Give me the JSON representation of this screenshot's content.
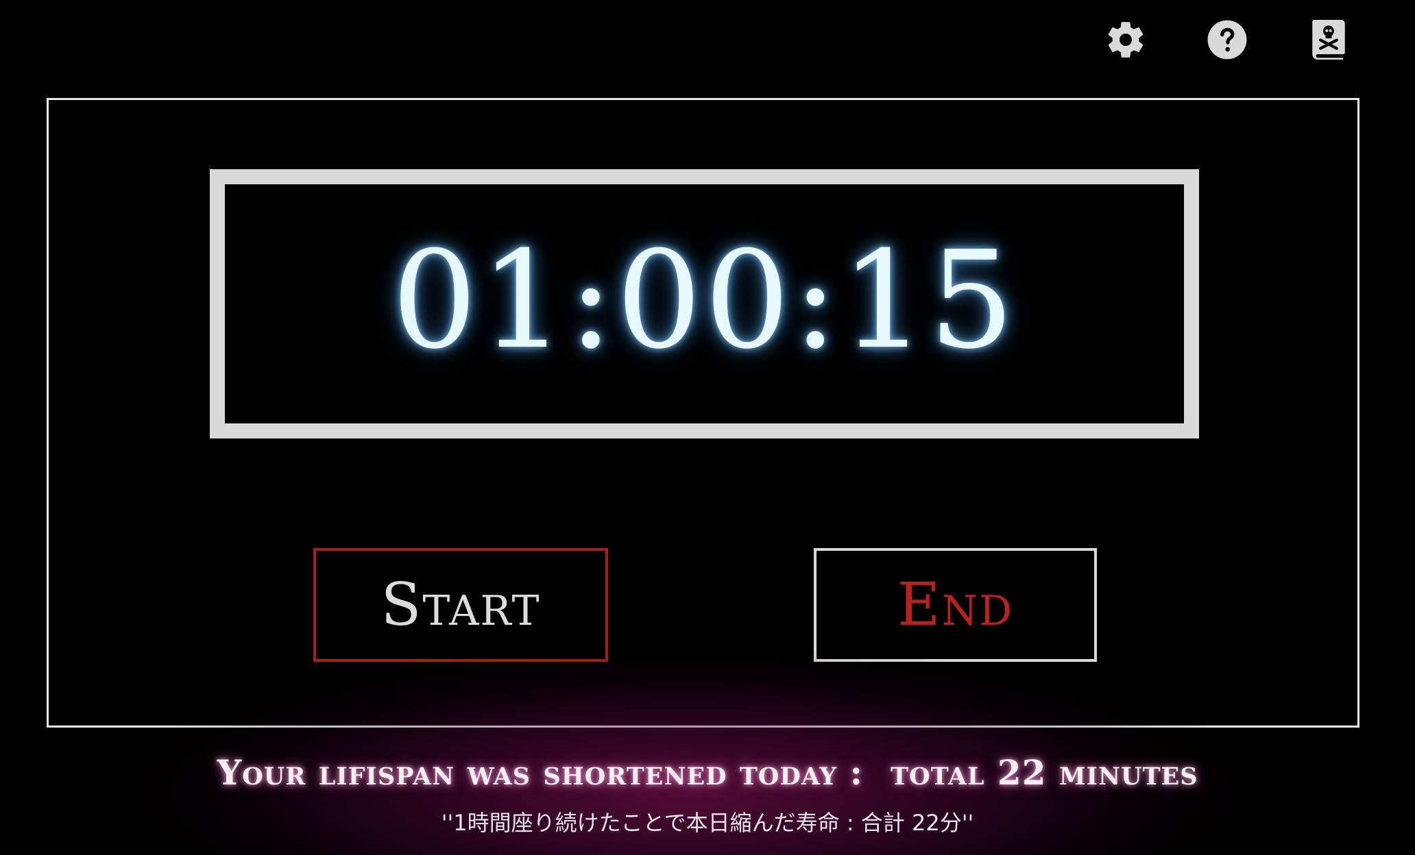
{
  "toolbar": {
    "icons": [
      "gear-icon",
      "help-icon",
      "skull-book-icon"
    ]
  },
  "timer": {
    "display": "01:00:15"
  },
  "buttons": {
    "start_label": "Start",
    "end_label": "End"
  },
  "lifespan": {
    "message": "Your lifispan was shortened today :",
    "total": "total 22 minutes",
    "japanese": "''1時間座り続けたことで本日縮んだ寿命 : 合計 22分''"
  },
  "colors": {
    "background": "#000000",
    "timer_glow": "#82c8ff",
    "start_border": "#a3221d",
    "end_text": "#b8221c",
    "bottom_glow": "#96146e"
  }
}
